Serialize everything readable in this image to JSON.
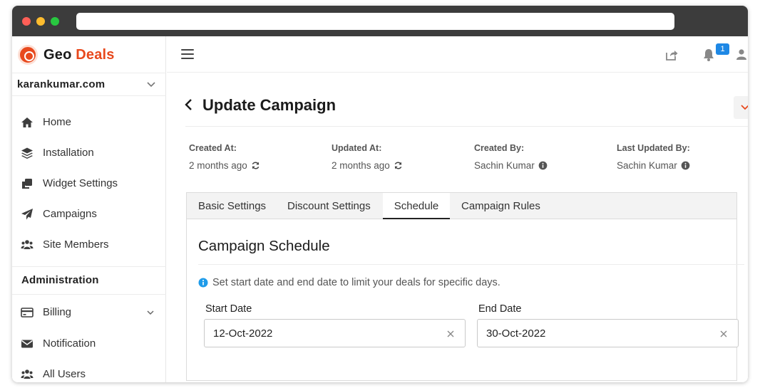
{
  "brand": {
    "part1": "Geo",
    "part2": "Deals",
    "accent": "#e8491d"
  },
  "site_selector": {
    "value": "karankumar.com"
  },
  "sidebar": {
    "items": [
      {
        "label": "Home",
        "icon": "home-icon"
      },
      {
        "label": "Installation",
        "icon": "layers-icon"
      },
      {
        "label": "Widget Settings",
        "icon": "clone-icon"
      },
      {
        "label": "Campaigns",
        "icon": "paper-plane-icon"
      },
      {
        "label": "Site Members",
        "icon": "users-icon"
      }
    ],
    "section_title": "Administration",
    "admin_items": [
      {
        "label": "Billing",
        "icon": "credit-card-icon"
      },
      {
        "label": "Notification",
        "icon": "envelope-icon"
      },
      {
        "label": "All Users",
        "icon": "users-icon"
      }
    ]
  },
  "topbar": {
    "notification_count": "1"
  },
  "page": {
    "title": "Update Campaign",
    "meta": [
      {
        "key": "Created At:",
        "value": "2 months ago"
      },
      {
        "key": "Updated At:",
        "value": "2 months ago"
      },
      {
        "key": "Created By:",
        "value": "Sachin Kumar"
      },
      {
        "key": "Last Updated By:",
        "value": "Sachin Kumar"
      }
    ]
  },
  "tabs": [
    "Basic Settings",
    "Discount Settings",
    "Schedule",
    "Campaign Rules"
  ],
  "active_tab": "Schedule",
  "schedule": {
    "title": "Campaign Schedule",
    "hint": "Set start date and end date to limit your deals for specific days.",
    "start_label": "Start Date",
    "start_value": "12-Oct-2022",
    "end_label": "End Date",
    "end_value": "30-Oct-2022"
  }
}
